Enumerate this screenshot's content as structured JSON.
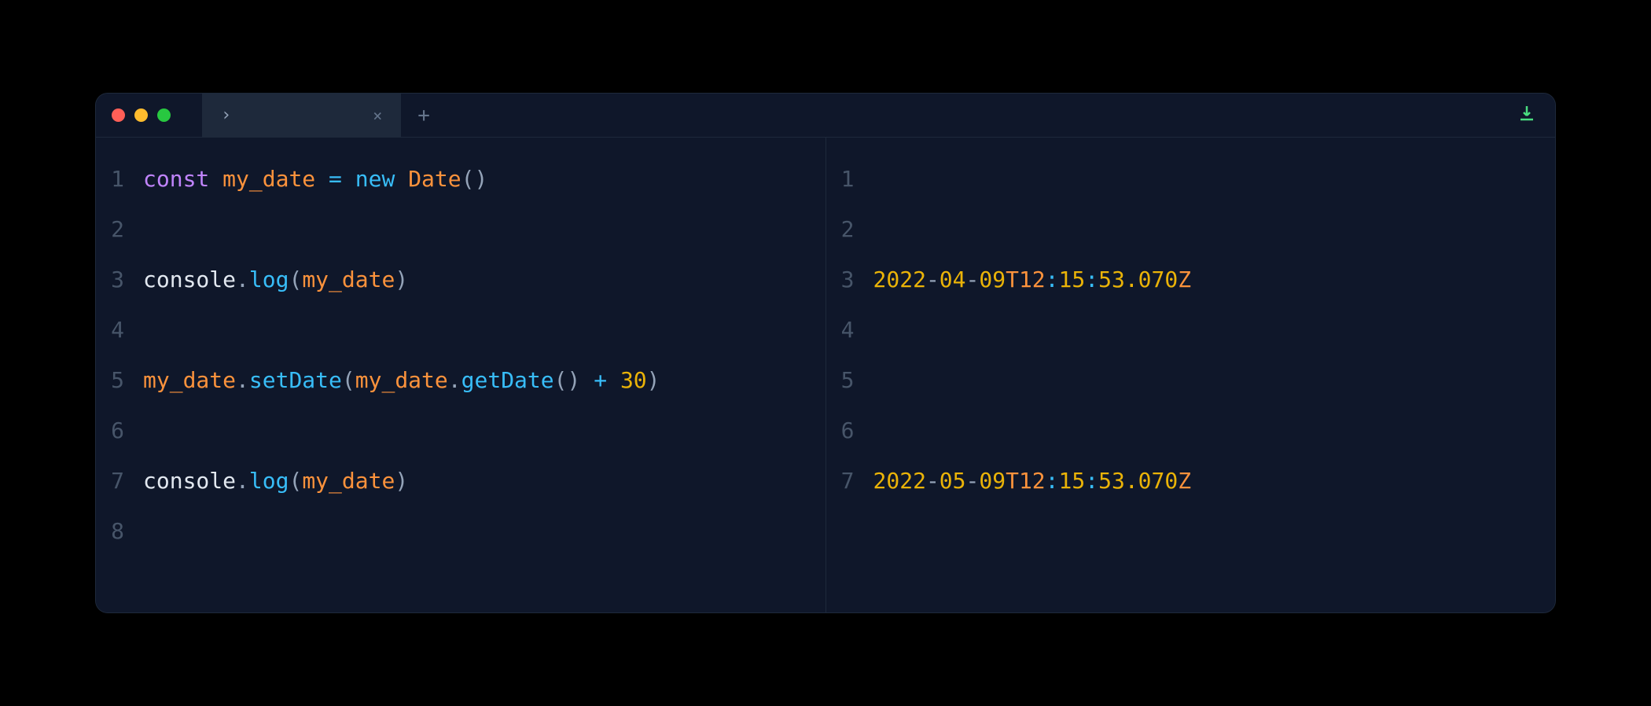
{
  "titlebar": {
    "tab_label": "›",
    "tab_close": "×",
    "new_tab": "+"
  },
  "left_pane": {
    "lines": [
      {
        "num": "1",
        "tokens": [
          {
            "cls": "tk-keyword",
            "text": "const"
          },
          {
            "cls": "tk-ident",
            "text": " "
          },
          {
            "cls": "tk-variable",
            "text": "my_date"
          },
          {
            "cls": "tk-ident",
            "text": " "
          },
          {
            "cls": "tk-operator",
            "text": "="
          },
          {
            "cls": "tk-ident",
            "text": " "
          },
          {
            "cls": "tk-operator",
            "text": "new"
          },
          {
            "cls": "tk-ident",
            "text": " "
          },
          {
            "cls": "tk-class",
            "text": "Date"
          },
          {
            "cls": "tk-punct",
            "text": "()"
          }
        ]
      },
      {
        "num": "2",
        "tokens": []
      },
      {
        "num": "3",
        "tokens": [
          {
            "cls": "tk-ident",
            "text": "console"
          },
          {
            "cls": "tk-punct",
            "text": "."
          },
          {
            "cls": "tk-method",
            "text": "log"
          },
          {
            "cls": "tk-punct",
            "text": "("
          },
          {
            "cls": "tk-variable",
            "text": "my_date"
          },
          {
            "cls": "tk-punct",
            "text": ")"
          }
        ]
      },
      {
        "num": "4",
        "tokens": []
      },
      {
        "num": "5",
        "tokens": [
          {
            "cls": "tk-variable",
            "text": "my_date"
          },
          {
            "cls": "tk-punct",
            "text": "."
          },
          {
            "cls": "tk-method",
            "text": "setDate"
          },
          {
            "cls": "tk-punct",
            "text": "("
          },
          {
            "cls": "tk-variable",
            "text": "my_date"
          },
          {
            "cls": "tk-punct",
            "text": "."
          },
          {
            "cls": "tk-method",
            "text": "getDate"
          },
          {
            "cls": "tk-punct",
            "text": "() "
          },
          {
            "cls": "tk-operator",
            "text": "+"
          },
          {
            "cls": "tk-ident",
            "text": " "
          },
          {
            "cls": "tk-number",
            "text": "30"
          },
          {
            "cls": "tk-punct",
            "text": ")"
          }
        ]
      },
      {
        "num": "6",
        "tokens": []
      },
      {
        "num": "7",
        "tokens": [
          {
            "cls": "tk-ident",
            "text": "console"
          },
          {
            "cls": "tk-punct",
            "text": "."
          },
          {
            "cls": "tk-method",
            "text": "log"
          },
          {
            "cls": "tk-punct",
            "text": "("
          },
          {
            "cls": "tk-variable",
            "text": "my_date"
          },
          {
            "cls": "tk-punct",
            "text": ")"
          }
        ]
      },
      {
        "num": "8",
        "tokens": []
      }
    ]
  },
  "right_pane": {
    "lines": [
      {
        "num": "1",
        "tokens": []
      },
      {
        "num": "2",
        "tokens": []
      },
      {
        "num": "3",
        "tokens": [
          {
            "cls": "tk-date-num",
            "text": "2022"
          },
          {
            "cls": "tk-punct",
            "text": "-"
          },
          {
            "cls": "tk-date-num",
            "text": "04"
          },
          {
            "cls": "tk-punct",
            "text": "-"
          },
          {
            "cls": "tk-date-num",
            "text": "09"
          },
          {
            "cls": "tk-date-t",
            "text": "T12"
          },
          {
            "cls": "tk-date-colon",
            "text": ":"
          },
          {
            "cls": "tk-date-num",
            "text": "15"
          },
          {
            "cls": "tk-date-colon",
            "text": ":"
          },
          {
            "cls": "tk-date-num",
            "text": "53.070"
          },
          {
            "cls": "tk-date-z",
            "text": "Z"
          }
        ]
      },
      {
        "num": "4",
        "tokens": []
      },
      {
        "num": "5",
        "tokens": []
      },
      {
        "num": "6",
        "tokens": []
      },
      {
        "num": "7",
        "tokens": [
          {
            "cls": "tk-date-num",
            "text": "2022"
          },
          {
            "cls": "tk-punct",
            "text": "-"
          },
          {
            "cls": "tk-date-num",
            "text": "05"
          },
          {
            "cls": "tk-punct",
            "text": "-"
          },
          {
            "cls": "tk-date-num",
            "text": "09"
          },
          {
            "cls": "tk-date-t",
            "text": "T12"
          },
          {
            "cls": "tk-date-colon",
            "text": ":"
          },
          {
            "cls": "tk-date-num",
            "text": "15"
          },
          {
            "cls": "tk-date-colon",
            "text": ":"
          },
          {
            "cls": "tk-date-num",
            "text": "53.070"
          },
          {
            "cls": "tk-date-z",
            "text": "Z"
          }
        ]
      }
    ]
  }
}
